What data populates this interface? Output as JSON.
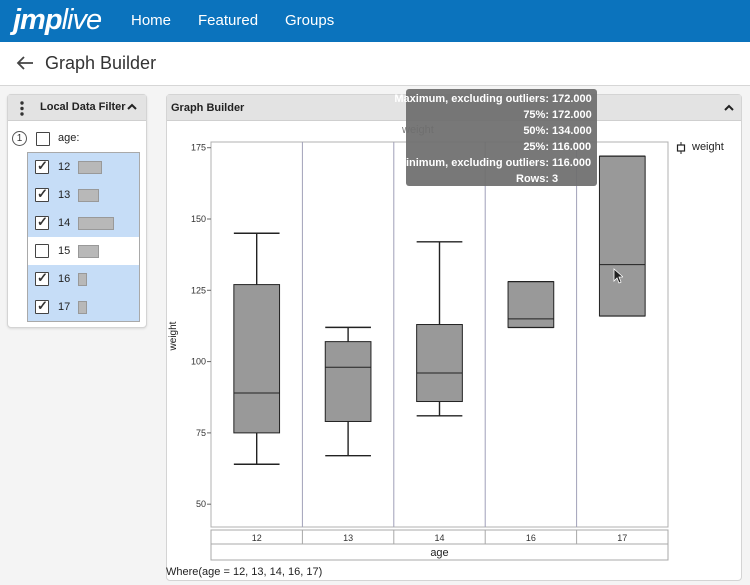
{
  "app": {
    "logo_bold": "jmp",
    "logo_rest": "live",
    "nav": [
      "Home",
      "Featured",
      "Groups"
    ]
  },
  "page": {
    "title": "Graph Builder"
  },
  "filter": {
    "title": "Local Data Filter",
    "index": "1",
    "column": "age:",
    "levels": [
      {
        "label": "12",
        "checked": true,
        "share": 0.32
      },
      {
        "label": "13",
        "checked": true,
        "share": 0.28
      },
      {
        "label": "14",
        "checked": true,
        "share": 0.48
      },
      {
        "label": "15",
        "checked": false,
        "share": 0.28
      },
      {
        "label": "16",
        "checked": true,
        "share": 0.12
      },
      {
        "label": "17",
        "checked": true,
        "share": 0.12
      }
    ]
  },
  "graph_builder": {
    "title": "Graph Builder",
    "graph_title": "weight",
    "legend": "weight",
    "where": "Where(age = 12, 13, 14, 16, 17)"
  },
  "tooltip": [
    {
      "label": "Maximum, excluding outliers:",
      "value": "172.000"
    },
    {
      "label": "75%:",
      "value": "172.000"
    },
    {
      "label": "50%:",
      "value": "134.000"
    },
    {
      "label": "25%:",
      "value": "116.000"
    },
    {
      "label": "Minimum, excluding outliers:",
      "value": "116.000"
    },
    {
      "label": "Rows:",
      "value": "3"
    }
  ],
  "chart_data": {
    "type": "box",
    "x_label": "age",
    "y_label": "weight",
    "ylim": [
      42,
      177
    ],
    "y_ticks": [
      50,
      75,
      100,
      125,
      150,
      175
    ],
    "categories": [
      "12",
      "13",
      "14",
      "16",
      "17"
    ],
    "boxes": [
      {
        "category": "12",
        "min": 64,
        "q1": 75,
        "median": 89,
        "q3": 127,
        "max": 145
      },
      {
        "category": "13",
        "min": 67,
        "q1": 79,
        "median": 98,
        "q3": 107,
        "max": 112
      },
      {
        "category": "14",
        "min": 81,
        "q1": 86,
        "median": 96,
        "q3": 113,
        "max": 142
      },
      {
        "category": "16",
        "min": 112,
        "q1": 112,
        "median": 115,
        "q3": 128,
        "max": 128
      },
      {
        "category": "17",
        "min": 116,
        "q1": 116,
        "median": 134,
        "q3": 172,
        "max": 172
      }
    ],
    "box_fill": "#999999"
  }
}
